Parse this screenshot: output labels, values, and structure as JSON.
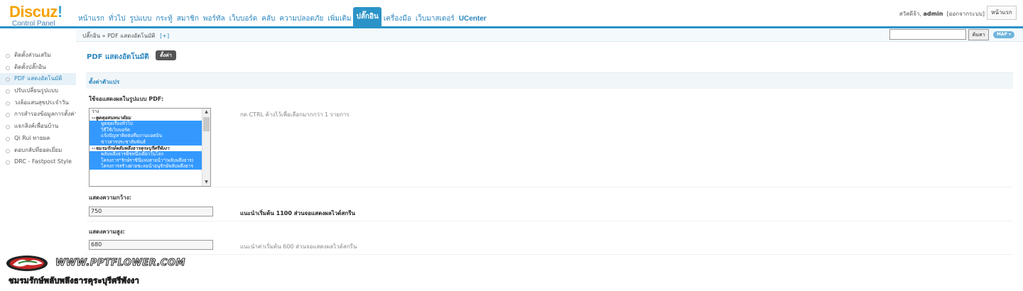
{
  "header": {
    "logo_main_d": "Discuz",
    "logo_main_z": "!",
    "logo_sub": "Control Panel",
    "nav": [
      {
        "label": "หน้าแรก",
        "active": false
      },
      {
        "label": "ทั่วไป",
        "active": false
      },
      {
        "label": "รูปแบบ",
        "active": false
      },
      {
        "label": "กระทู้",
        "active": false
      },
      {
        "label": "สมาชิก",
        "active": false
      },
      {
        "label": "พอร์ทัล",
        "active": false
      },
      {
        "label": "เว็บบอร์ด",
        "active": false
      },
      {
        "label": "คลับ",
        "active": false
      },
      {
        "label": "ความปลอดภัย",
        "active": false
      },
      {
        "label": "เพิ่มเติม",
        "active": false
      },
      {
        "label": "ปลั๊กอิน",
        "active": true
      },
      {
        "label": "เครื่องมือ",
        "active": false
      },
      {
        "label": "เว็บมาสเตอร์",
        "active": false
      },
      {
        "label": "UCenter",
        "active": false
      }
    ],
    "greeting": "สวัสดีจ้า,",
    "username": "admin",
    "logout": "[ออกจากระบบ]",
    "home_button": "หน้าแรก"
  },
  "subbar": {
    "breadcrumb_root": "ปลั๊กอิน",
    "breadcrumb_sep": "»",
    "breadcrumb_current": "PDF แสดงอัตโนมัติ",
    "add_label": "[+]",
    "search_value": "",
    "search_button": "ค้นหา",
    "map_button": "MAP ▾"
  },
  "sidebar": {
    "items": [
      {
        "label": "ติดตั้งส่วนเสริม",
        "active": false
      },
      {
        "label": "ติดตั้งปลั๊กอิน",
        "active": false
      },
      {
        "label": "PDF แสดงอัตโนมัติ",
        "active": true
      },
      {
        "label": "ปรับเปลี่ยนรูปแบบ",
        "active": false
      },
      {
        "label": "วงล้อแสนสุขประจำวัน",
        "active": false
      },
      {
        "label": "การสำรองข้อมูลการตั้งค่า",
        "active": false
      },
      {
        "label": "แจกลิงค์เพื่อนบ้าน",
        "active": false
      },
      {
        "label": "Qi Rui ทายผล",
        "active": false
      },
      {
        "label": "ตอบกลับที่ยอดเยี่ยม",
        "active": false
      },
      {
        "label": "DRC - Fastpost Style",
        "active": false
      }
    ]
  },
  "main": {
    "title": "PDF แสดงอัตโนมัติ",
    "settings_badge": "ตั้งค่า",
    "section_title": "ตั้งค่าตัวแปร",
    "forum_label": "ใช้จอแสดงผลในรูปแบบ PDF:",
    "forum_hint": "กด CTRL ค้างไว้เพื่อเลือกมากกว่า 1 รายการ",
    "forum_options": [
      {
        "label": "ว่าง",
        "type": "plain"
      },
      {
        "label": "--พูดคุยสนทนาดัยม",
        "type": "group"
      },
      {
        "label": "พูดคุยเรื่องทั่วไป",
        "type": "sel"
      },
      {
        "label": "วิธีใช้เว็บบอร์ด",
        "type": "sel"
      },
      {
        "label": "แจ้งปัญหาติดต่อทีมงานแอดมิน",
        "type": "sel"
      },
      {
        "label": "ข่าวสารประชาสัมพันธ์",
        "type": "sel"
      },
      {
        "label": "--ชมรมรักษ์พลับพลึงธารคุระบุรีศรีพังงา",
        "type": "group"
      },
      {
        "label": "พลับพลึงธารพืชหนึ่งเดียวในโลก",
        "type": "sel"
      },
      {
        "label": "โครงการ\"รักษ์ราชินีแห่งสายน้ำ\"(พลับพลึงธาร)",
        "type": "sel"
      },
      {
        "label": "โครงการสร้างฝายชะลอน้ำอนุรักษ์พลับพลึงธาร",
        "type": "sel"
      }
    ],
    "scroll_up": "▲",
    "scroll_down": "▼",
    "width_label": "แสดงความกว้าง:",
    "width_value": "750",
    "width_hint": "แนะนำเริ่มต้น 1100 ส่วนจอแสดงผลไวด์สกรีน",
    "height_label": "แสดงความสูง:",
    "height_value": "680",
    "height_hint": "แนะนำค่าเริ่มต้น 600 ส่วนจอแสดงผลไวด์สกรีน"
  },
  "watermark": {
    "url": "WWW.PPTFLOWER.COM",
    "name": "ชมรมรักษ์พลับพลึงธารคุระบุรีศรีพังงา"
  }
}
